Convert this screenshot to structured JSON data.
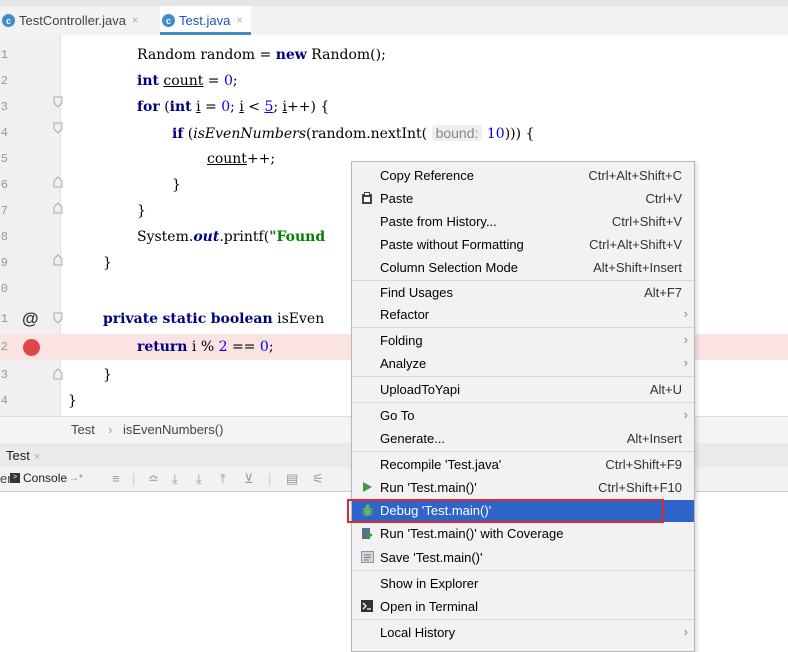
{
  "tabs": [
    {
      "label": "TestController.java",
      "icon": "c",
      "active": false
    },
    {
      "label": "Test.java",
      "icon": "c",
      "active": true
    }
  ],
  "close_glyph": "×",
  "editor": {
    "lines": [
      {
        "num": "1"
      },
      {
        "num": "2"
      },
      {
        "num": "3"
      },
      {
        "num": "4"
      },
      {
        "num": "5"
      },
      {
        "num": "6"
      },
      {
        "num": "7"
      },
      {
        "num": "8"
      },
      {
        "num": "9"
      },
      {
        "num": "0"
      },
      {
        "num": "1"
      },
      {
        "num": "2"
      },
      {
        "num": "3"
      },
      {
        "num": "4"
      }
    ],
    "hint_bound": "bound:",
    "gutter_at": "@",
    "tokens": {
      "random_decl": "Random random = ",
      "new": "new",
      "random_ctor": " Random();",
      "int": "int",
      "count": "count",
      "assign_zero": " = ",
      "zero": "0",
      "semi": ";",
      "for": "for",
      "for_open": " (",
      "i": "i",
      "lt": " < ",
      "five": "5",
      "ipp": "++) {",
      "if": "if",
      "if_open": " (",
      "isEven": "isEvenNumbers",
      "nextInt": "(random.nextInt( ",
      "ten": "10",
      "close3": "))) {",
      "countpp_tail": "++;",
      "brace_close": "}",
      "sysout_pre": "System.",
      "out": "out",
      "printf": ".printf(",
      "found": "\"Found",
      "private": "private",
      "static": "static",
      "boolean": "boolean",
      "isEven_trunc": " isEven",
      "return": "return",
      "ret_expr": " i % ",
      "two": "2",
      "eq": " == ",
      "ret_end": ";"
    }
  },
  "breadcrumb": {
    "items": [
      "Test",
      "isEvenNumbers()"
    ],
    "sep": "›"
  },
  "run_panel": {
    "tab": "Test",
    "console": "Console",
    "console_suffix": "→*",
    "left_cut": "er"
  },
  "context_menu": {
    "items": [
      {
        "label": "Copy Reference",
        "shortcut": "Ctrl+Alt+Shift+C"
      },
      {
        "label": "Paste",
        "shortcut": "Ctrl+V",
        "icon": "paste-icon"
      },
      {
        "label": "Paste from History...",
        "shortcut": "Ctrl+Shift+V"
      },
      {
        "label": "Paste without Formatting",
        "shortcut": "Ctrl+Alt+Shift+V"
      },
      {
        "label": "Column Selection Mode",
        "shortcut": "Alt+Shift+Insert"
      },
      {
        "label": "Find Usages",
        "shortcut": "Alt+F7"
      },
      {
        "label": "Refactor",
        "shortcut": ""
      },
      {
        "label": "Folding",
        "shortcut": ""
      },
      {
        "label": "Analyze",
        "shortcut": ""
      },
      {
        "label": "UploadToYapi",
        "shortcut": "Alt+U"
      },
      {
        "label": "Go To",
        "shortcut": ""
      },
      {
        "label": "Generate...",
        "shortcut": "Alt+Insert"
      },
      {
        "label": "Recompile 'Test.java'",
        "shortcut": "Ctrl+Shift+F9"
      },
      {
        "label": "Run 'Test.main()'",
        "shortcut": "Ctrl+Shift+F10",
        "icon": "run-icon"
      },
      {
        "label": "Debug 'Test.main()'",
        "shortcut": "",
        "icon": "debug-icon",
        "selected": true
      },
      {
        "label": "Run 'Test.main()' with Coverage",
        "shortcut": "",
        "icon": "coverage-icon"
      },
      {
        "label": "Save 'Test.main()'",
        "shortcut": "",
        "icon": "save-config-icon"
      },
      {
        "label": "Show in Explorer",
        "shortcut": ""
      },
      {
        "label": "Open in Terminal",
        "shortcut": "",
        "icon": "terminal-icon"
      },
      {
        "label": "Local History",
        "shortcut": ""
      }
    ]
  },
  "colors": {
    "selection": "#2f65ca",
    "breakpoint": "#e04848",
    "breakpoint_line": "#fbe3e4",
    "highlight_box": "#e0262f",
    "keyword": "#000080",
    "number": "#0000ff"
  }
}
